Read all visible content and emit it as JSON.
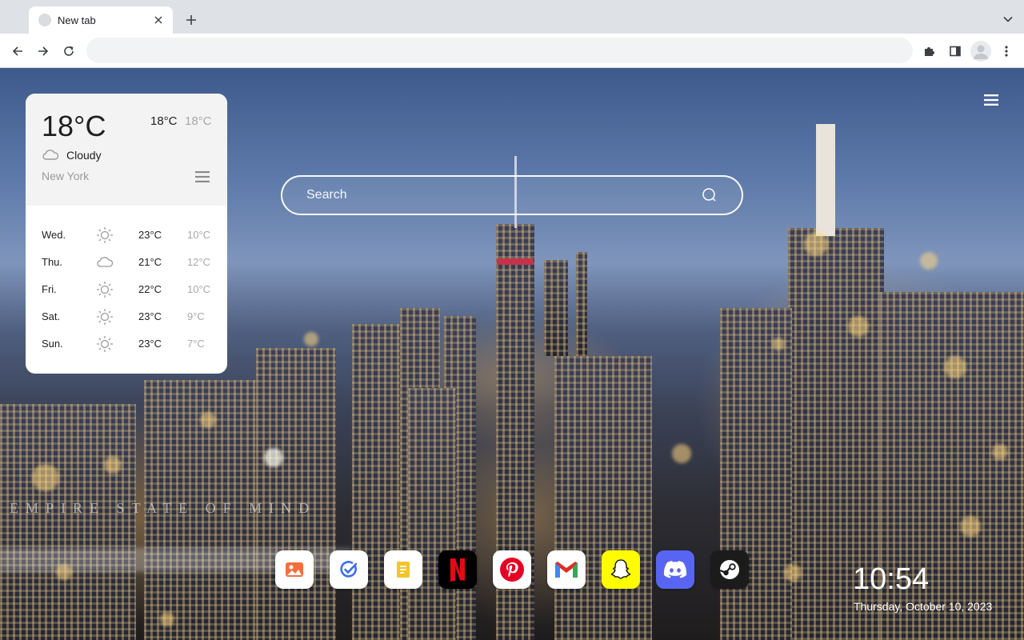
{
  "tab": {
    "title": "New tab"
  },
  "omnibox": {
    "value": ""
  },
  "weather": {
    "current_temp": "18°C",
    "high": "18°C",
    "low": "18°C",
    "condition": "Cloudy",
    "condition_icon": "cloud-icon",
    "city": "New York",
    "forecast": [
      {
        "day": "Wed.",
        "icon": "sun-icon",
        "high": "23°C",
        "low": "10°C"
      },
      {
        "day": "Thu.",
        "icon": "cloud-icon",
        "high": "21°C",
        "low": "12°C"
      },
      {
        "day": "Fri.",
        "icon": "sun-icon",
        "high": "22°C",
        "low": "10°C"
      },
      {
        "day": "Sat.",
        "icon": "sun-icon",
        "high": "23°C",
        "low": "9°C"
      },
      {
        "day": "Sun.",
        "icon": "sun-icon",
        "high": "23°C",
        "low": "7°C"
      }
    ]
  },
  "search": {
    "placeholder": "Search"
  },
  "watermark": "EMPIRE STATE OF MIND",
  "dock": [
    {
      "name": "photos",
      "icon": "image-icon",
      "bg": "#ffffff"
    },
    {
      "name": "tasks",
      "icon": "check-circle-icon",
      "bg": "#ffffff"
    },
    {
      "name": "notes",
      "icon": "note-icon",
      "bg": "#ffffff"
    },
    {
      "name": "netflix",
      "icon": "netflix-icon",
      "bg": "#000000"
    },
    {
      "name": "pinterest",
      "icon": "pinterest-icon",
      "bg": "#ffffff"
    },
    {
      "name": "gmail",
      "icon": "gmail-icon",
      "bg": "#ffffff"
    },
    {
      "name": "snapchat",
      "icon": "snapchat-icon",
      "bg": "#fffc00"
    },
    {
      "name": "discord",
      "icon": "discord-icon",
      "bg": "#5865f2"
    },
    {
      "name": "steam",
      "icon": "steam-icon",
      "bg": "#1b1b1b"
    }
  ],
  "clock": {
    "time": "10:54",
    "date": "Thursday, October 10, 2023"
  }
}
